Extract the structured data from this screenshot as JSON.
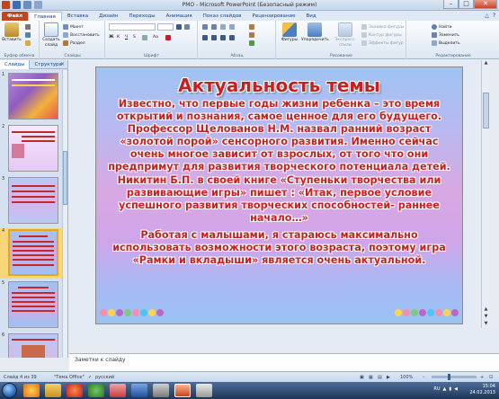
{
  "window": {
    "title": "РМО  -  Microsoft PowerPoint (Безопасный режим)",
    "minimize": "–",
    "maximize": "□",
    "close": "✕"
  },
  "ribbon_tabs": [
    "Файл",
    "Главная",
    "Вставка",
    "Дизайн",
    "Переходы",
    "Анимация",
    "Показ слайдов",
    "Рецензирование",
    "Вид"
  ],
  "ribbon": {
    "clipboard": {
      "paste": "Вставить",
      "label": "Буфер обмена"
    },
    "slides": {
      "create": "Создать слайд",
      "layout": "Макет",
      "reset": "Восстановить",
      "section": "Раздел",
      "label": "Слайды"
    },
    "font": {
      "label": "Шрифт"
    },
    "paragraph": {
      "label": "Абзац"
    },
    "drawing": {
      "shapes": "Фигуры",
      "arrange": "Упорядочить",
      "quick_styles": "Экспресс-стили",
      "fill": "Заливка фигуры",
      "outline": "Контур фигуры",
      "effects": "Эффекты фигур",
      "label": "Рисование"
    },
    "editing": {
      "find": "Найти",
      "replace": "Заменить",
      "select": "Выделить",
      "label": "Редактирование"
    }
  },
  "panel_tabs": {
    "slides": "Слайды",
    "outline": "Структура",
    "close": "×"
  },
  "thumbnails": [
    "1",
    "2",
    "3",
    "4",
    "5",
    "6"
  ],
  "slide": {
    "title": "Актуальность темы",
    "paragraph1": "Известно, что первые годы жизни ребенка – это время открытий и познания, самое ценное для его будущего. Профессор Щелованов Н.М. назвал ранний возраст «золотой порой» сенсорного развития. Именно сейчас очень многое зависит от взрослых, от того что они предпримут для развития творческого потенциала детей. Никитин Б.П. в своей книге «Ступеньки творчества или развивающие игры» пишет : «Итак, первое условие успешного развития творческих способностей- раннее начало…»",
    "paragraph2": "Работая с малышами, я стараюсь максимально использовать возможности этого возраста, поэтому игра «Рамки и вкладыши» является очень актуальной."
  },
  "notes": {
    "placeholder": "Заметки к слайду"
  },
  "status": {
    "slide": "Слайд 4 из 39",
    "theme": "\"Тема Office\"",
    "language": "русский",
    "zoom": "100%"
  },
  "tray": {
    "lang": "RU",
    "time": "15:04",
    "date": "24.02.2013"
  }
}
